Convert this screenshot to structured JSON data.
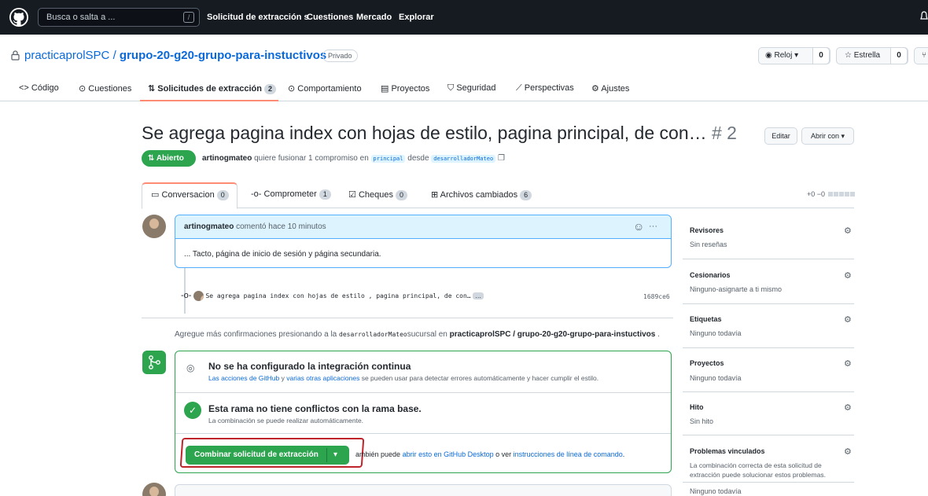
{
  "header": {
    "search_placeholder": "Busca o salta a ...",
    "search_key": "/",
    "nav": [
      "Solicitud de extracción s",
      "Cuestiones",
      "Mercado",
      "Explorar"
    ]
  },
  "repo": {
    "owner": "practicaprolSPC",
    "separator": "/",
    "name": "grupo-20-g20-grupo-para-instuctivos",
    "visibility": "Privado",
    "watch_label": "Reloj",
    "watch_count": "0",
    "star_label": "Estrella",
    "star_count": "0"
  },
  "tabs": [
    {
      "label": "Código"
    },
    {
      "label": "Cuestiones"
    },
    {
      "label": "Solicitudes de extracción",
      "count": "2"
    },
    {
      "label": "Comportamiento"
    },
    {
      "label": "Proyectos"
    },
    {
      "label": "Seguridad"
    },
    {
      "label": "Perspectivas"
    },
    {
      "label": "Ajustes"
    }
  ],
  "pr": {
    "title": "Se agrega pagina index con hojas de estilo, pagina principal, de con…",
    "number": "# 2",
    "edit_label": "Editar",
    "open_with_label": "Abrir con",
    "state": "Abierto",
    "author": "artinogmateo",
    "meta_text": "quiere fusionar 1 compromiso en",
    "base_branch": "principal",
    "from_text": "desde",
    "head_branch": "desarrolladorMateo"
  },
  "pr_tabs": [
    {
      "label": "Conversacion",
      "count": "0"
    },
    {
      "label": "Comprometer",
      "count": "1"
    },
    {
      "label": "Cheques",
      "count": "0"
    },
    {
      "label": "Archivos cambiados",
      "count": "6"
    }
  ],
  "diffstat": "+0 −0",
  "comment": {
    "author": "artinogmateo",
    "action": "comentó hace 10 minutos",
    "more": "···",
    "body": "... Tacto, página de inicio de sesión y página secundaria."
  },
  "commit": {
    "message": "Se agrega pagina index con hojas de estilo , pagina principal, de con…",
    "ellipsis": "…",
    "sha": "1689ce6"
  },
  "add_more": {
    "prefix": "Agregue más confirmaciones presionando a la",
    "branch": "desarrolladorMateo",
    "middle": "sucursal en",
    "repo": "practicaprolSPC / grupo-20-g20-grupo-para-instuctivos",
    "suffix": "."
  },
  "ci": {
    "title": "No se ha configurado la integración continua",
    "link1": "Las acciones de GitHub",
    "mid": "y",
    "link2": "varias otras aplicaciones",
    "rest": "se pueden usar para detectar errores automáticamente y hacer cumplir el estilo."
  },
  "conflicts": {
    "title": "Esta rama no tiene conflictos con la rama base.",
    "subtitle": "La combinación se puede realizar automáticamente."
  },
  "merge": {
    "button": "Combinar solicitud de extracción",
    "alt_prefix": "ambién puede",
    "alt_link1": "abrir esto en GitHub Desktop",
    "alt_or": "o ver",
    "alt_link2": "instrucciones de línea de comando",
    "alt_suffix": "."
  },
  "sidebar": [
    {
      "title": "Revisores",
      "value": "Sin reseñas"
    },
    {
      "title": "Cesionarios",
      "value": "Ninguno-asignarte a ti mismo"
    },
    {
      "title": "Etiquetas",
      "value": "Ninguno todavía"
    },
    {
      "title": "Proyectos",
      "value": "Ninguno todavía"
    },
    {
      "title": "Hito",
      "value": "Sin hito"
    },
    {
      "title": "Problemas vinculados",
      "value": "La combinación correcta de esta solicitud de",
      "value2": "extracción puede solucionar estos problemas.",
      "value3": "Ninguno todavía"
    }
  ],
  "colors": {
    "header_bg": "#161b22",
    "open_green": "#2da44e",
    "link_blue": "#0969da",
    "tab_underline": "#fd8c73",
    "annotation_red": "#c0242b"
  }
}
